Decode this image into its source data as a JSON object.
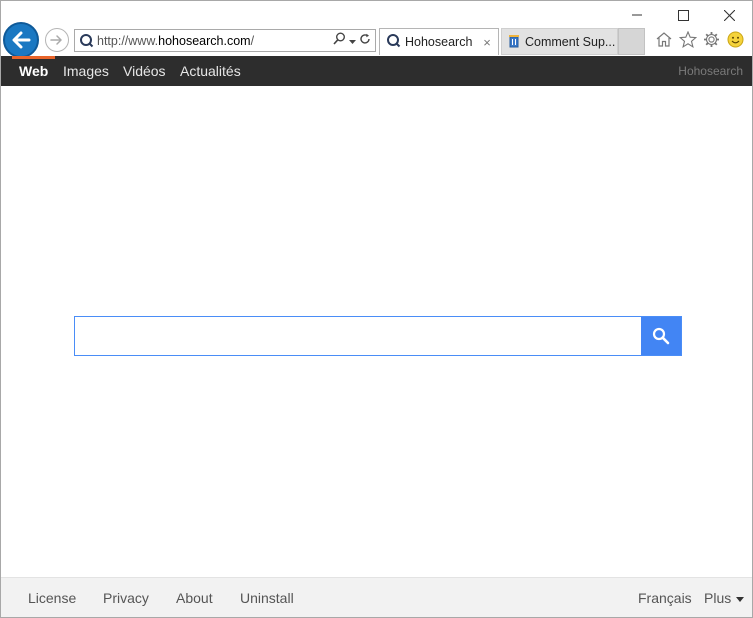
{
  "browser": {
    "address": {
      "scheme": "http://www.",
      "host": "hohosearch.com",
      "path": "/"
    },
    "tabs": [
      {
        "label": "Hohosearch",
        "close": "×"
      },
      {
        "label": "Comment Sup..."
      }
    ]
  },
  "site_nav": {
    "items": [
      "Web",
      "Images",
      "Vidéos",
      "Actualités"
    ],
    "brand": "Hohosearch"
  },
  "search": {
    "value": "",
    "placeholder": "",
    "button_color": "#4285f4"
  },
  "footer": {
    "links": [
      "License",
      "Privacy",
      "About",
      "Uninstall"
    ],
    "language": "Français",
    "more": "Plus"
  },
  "colors": {
    "nav_bg": "#2d2d2d",
    "nav_active_accent": "#e8642a",
    "back_button": "#1a78c2",
    "search_border": "#4a8df7"
  }
}
